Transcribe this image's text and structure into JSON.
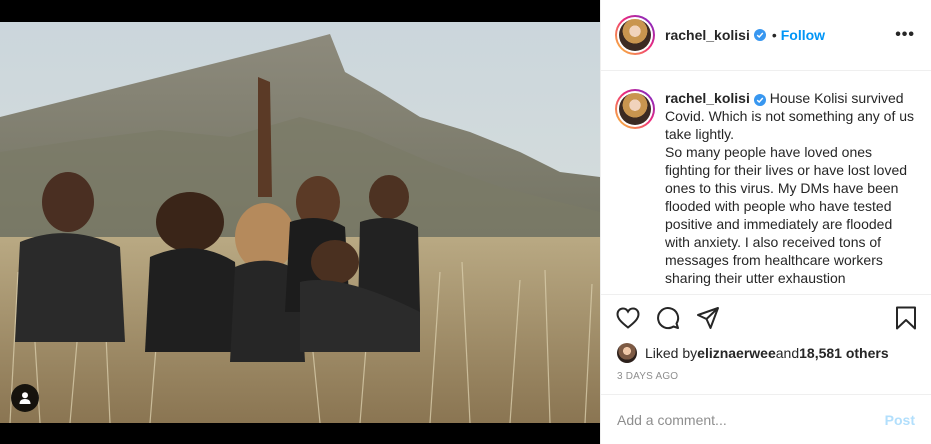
{
  "post": {
    "username": "rachel_kolisi",
    "follow_label": "Follow",
    "separator": "•",
    "more_label": "•••",
    "caption": "House Kolisi survived Covid. Which is not something any of us take lightly.\nSo many people have loved ones fighting for their lives or have lost loved ones to this virus. My DMs have been flooded with people who have tested positive and immediately are flooded with anxiety. I also received tons of messages from healthcare workers sharing their utter exhaustion",
    "liked_by_prefix": "Liked by ",
    "liked_by_user": "eliznaerwee",
    "liked_by_and": " and ",
    "liked_by_count": "18,581 others",
    "timestamp": "3 DAYS AGO"
  },
  "comment": {
    "placeholder": "Add a comment...",
    "post_label": "Post"
  },
  "colors": {
    "link_blue": "#0095f6",
    "verified_blue": "#3897f0",
    "post_disabled": "#b2dffc"
  },
  "icons": {
    "like": "heart-icon",
    "comment": "comment-bubble-icon",
    "share": "paper-plane-icon",
    "save": "bookmark-icon",
    "tag": "user-tag-icon",
    "verified": "verified-badge-icon"
  }
}
